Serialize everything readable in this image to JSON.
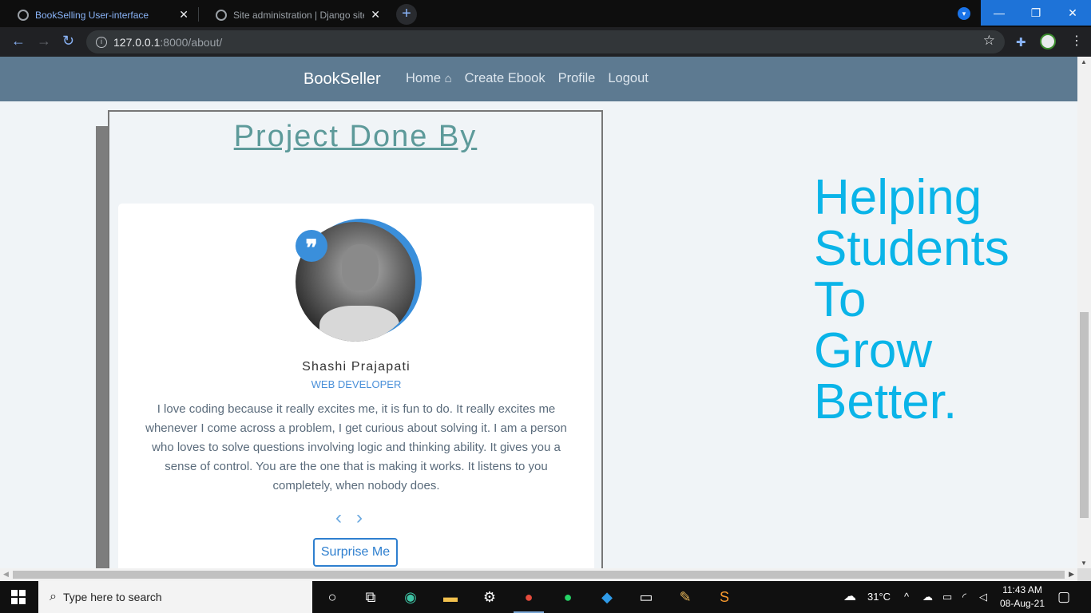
{
  "browser": {
    "tabs": [
      {
        "title": "BookSelling User-interface",
        "close": "✕"
      },
      {
        "title": "Site administration | Django site",
        "close": "✕"
      }
    ],
    "new_tab": "+",
    "window_controls": {
      "minimize": "—",
      "restore": "❐",
      "close": "✕"
    },
    "url_host": "127.0.0.1",
    "url_path": ":8000/about/"
  },
  "navbar": {
    "brand": "BookSeller",
    "links": [
      "Home",
      "Create Ebook",
      "Profile",
      "Logout"
    ],
    "home_icon": "⌂"
  },
  "panel": {
    "title": "Project Done By",
    "card": {
      "quote_mark": "❞",
      "name": "Shashi Prajapati",
      "role": "WEB DEVELOPER",
      "bio": "I love coding because it really excites me, it is fun to do. It really excites me whenever I come across a problem, I get curious about solving it. I am a person who loves to solve questions involving logic and thinking ability. It gives you a sense of control. You are the one that is making it works. It listens to you completely, when nobody does.",
      "prev": "‹",
      "next": "›",
      "button_label": "Surprise Me"
    }
  },
  "tagline": [
    "Helping",
    "Students",
    "To",
    "Grow",
    "Better."
  ],
  "taskbar": {
    "search_placeholder": "Type here to search",
    "weather": "31°C",
    "time": "11:43 AM",
    "date": "08-Aug-21"
  },
  "colors": {
    "navbar_bg": "#5d7a91",
    "accent_blue": "#3a8fdb",
    "tagline": "#0ab4e8",
    "title_teal": "#5d9a9a"
  }
}
